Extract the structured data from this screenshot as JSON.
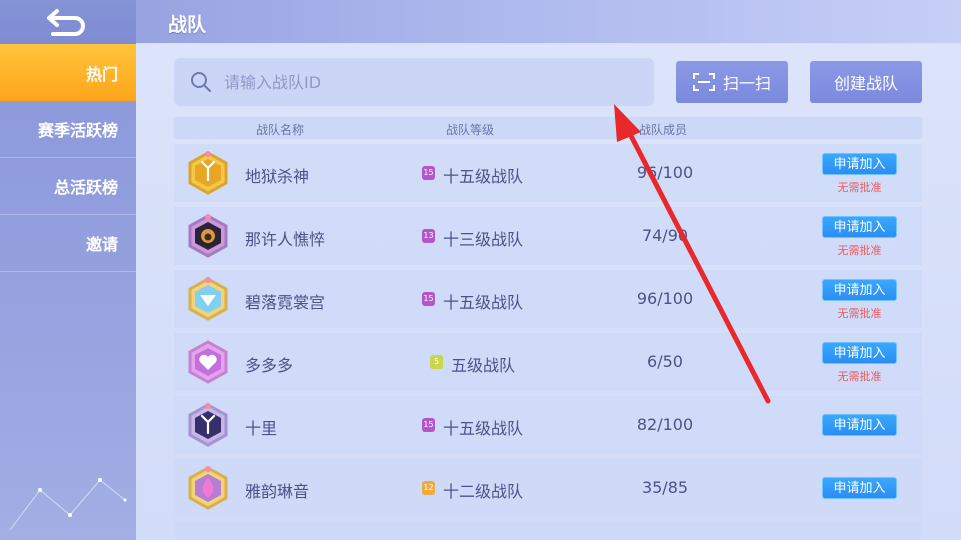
{
  "header": {
    "title": "战队"
  },
  "sidebar": {
    "items": [
      {
        "label": "热门"
      },
      {
        "label": "赛季活跃榜"
      },
      {
        "label": "总活跃榜"
      },
      {
        "label": "邀请"
      }
    ]
  },
  "search": {
    "placeholder": "请输入战队ID",
    "value": ""
  },
  "actions": {
    "scan_label": "扫一扫",
    "create_label": "创建战队"
  },
  "table": {
    "columns": [
      "战队名称",
      "战队等级",
      "战队成员"
    ],
    "rows": [
      {
        "name": "地狱杀神",
        "level_num": "15",
        "level": "十五级战队",
        "members": "96/100",
        "apply": "申请加入",
        "note": "无需批准",
        "badge_color": "#f5c23a",
        "level_color": "#b455c9"
      },
      {
        "name": "那许人憔悴",
        "level_num": "13",
        "level": "十三级战队",
        "members": "74/90",
        "apply": "申请加入",
        "note": "无需批准",
        "badge_color": "#3a2a4a",
        "level_color": "#b455c9"
      },
      {
        "name": "碧落霓裳宫",
        "level_num": "15",
        "level": "十五级战队",
        "members": "96/100",
        "apply": "申请加入",
        "note": "无需批准",
        "badge_color": "#7fd6f5",
        "level_color": "#b455c9"
      },
      {
        "name": "多多多",
        "level_num": "5",
        "level": "五级战队",
        "members": "6/50",
        "apply": "申请加入",
        "note": "无需批准",
        "badge_color": "#d68be8",
        "level_color": "#c8d84a"
      },
      {
        "name": "十里",
        "level_num": "15",
        "level": "十五级战队",
        "members": "82/100",
        "apply": "申请加入",
        "note": "",
        "badge_color": "#3e3a78",
        "level_color": "#b455c9"
      },
      {
        "name": "雅韵琳音",
        "level_num": "12",
        "level": "十二级战队",
        "members": "35/85",
        "apply": "申请加入",
        "note": "",
        "badge_color": "#b87cd8",
        "level_color": "#f0a93a"
      }
    ]
  },
  "colors": {
    "accent": "#ffa51a",
    "button": "#7b89dd",
    "apply": "#2a8ef2",
    "annotation_arrow": "#e8282a"
  },
  "icons": {
    "back": "back-arrow-icon",
    "search": "search-icon",
    "scan": "scan-icon"
  }
}
